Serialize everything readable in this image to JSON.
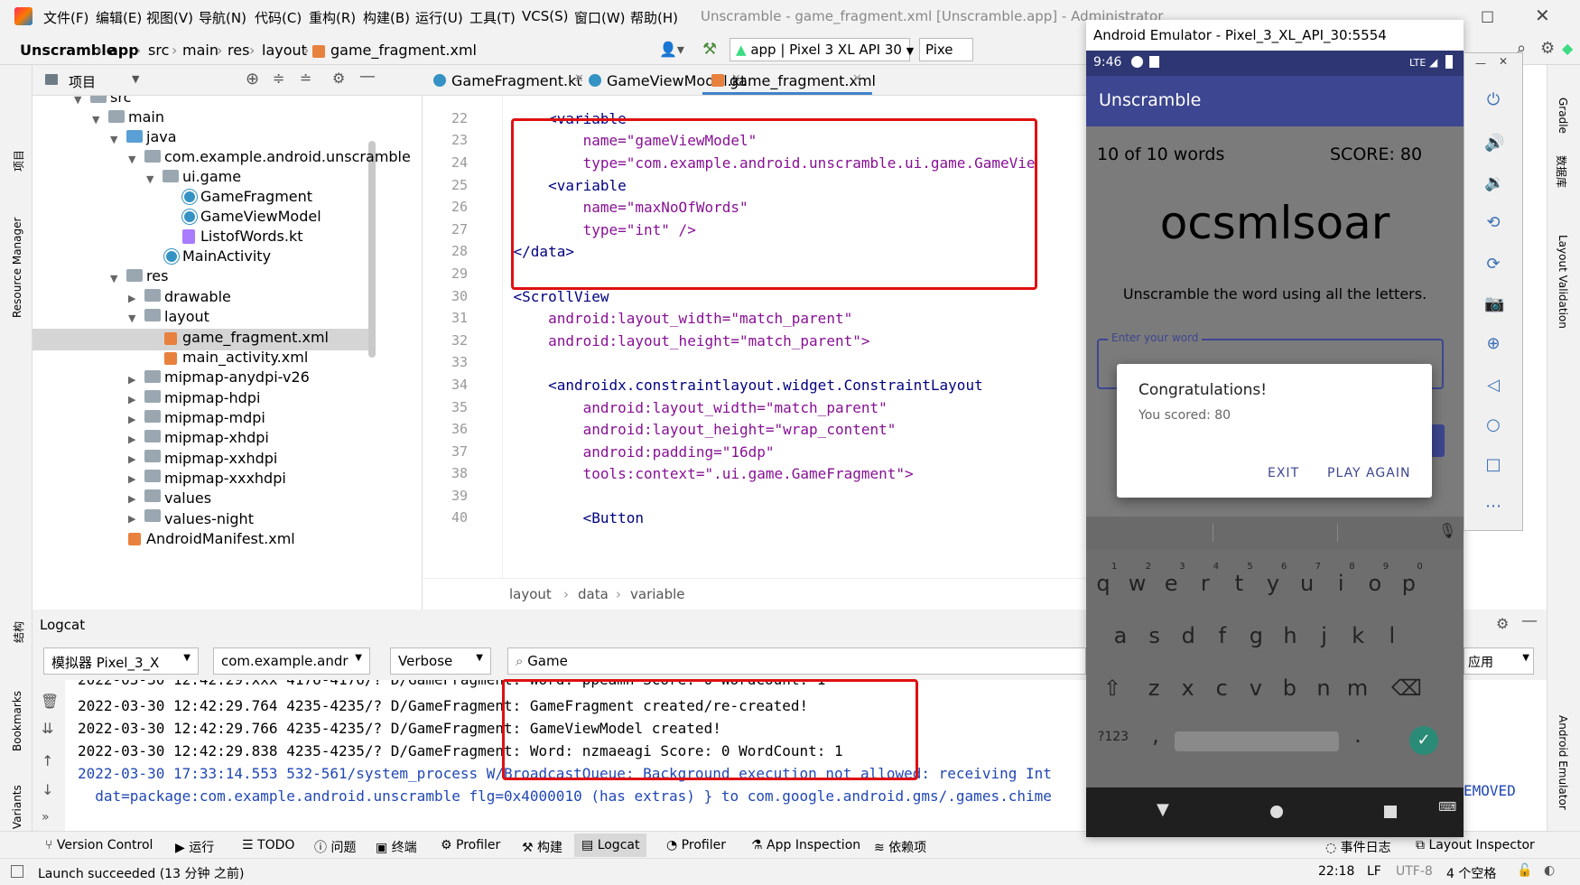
{
  "window": {
    "title": "Unscramble - game_fragment.xml [Unscramble.app] - Administrator",
    "menu": [
      "文件(F)",
      "编辑(E)",
      "视图(V)",
      "导航(N)",
      "代码(C)",
      "重构(R)",
      "构建(B)",
      "运行(U)",
      "工具(T)",
      "VCS(S)",
      "窗口(W)",
      "帮助(H)"
    ]
  },
  "breadcrumb": [
    "Unscramble",
    "app",
    "src",
    "main",
    "res",
    "layout",
    "game_fragment.xml"
  ],
  "run_config": "app | Pixel 3 XL API 30",
  "device_partial": "Pixe",
  "project_panel": {
    "title": "项目",
    "items": [
      {
        "label": "src"
      },
      {
        "label": "main"
      },
      {
        "label": "java"
      },
      {
        "label": "com.example.android.unscramble"
      },
      {
        "label": "ui.game"
      },
      {
        "label": "GameFragment"
      },
      {
        "label": "GameViewModel"
      },
      {
        "label": "ListofWords.kt"
      },
      {
        "label": "MainActivity"
      },
      {
        "label": "res"
      },
      {
        "label": "drawable"
      },
      {
        "label": "layout"
      },
      {
        "label": "game_fragment.xml"
      },
      {
        "label": "main_activity.xml"
      },
      {
        "label": "mipmap-anydpi-v26"
      },
      {
        "label": "mipmap-hdpi"
      },
      {
        "label": "mipmap-mdpi"
      },
      {
        "label": "mipmap-xhdpi"
      },
      {
        "label": "mipmap-xxhdpi"
      },
      {
        "label": "mipmap-xxxhdpi"
      },
      {
        "label": "values"
      },
      {
        "label": "values-night"
      },
      {
        "label": "AndroidManifest.xml"
      }
    ]
  },
  "editor_tabs": [
    "GameFragment.kt",
    "GameViewModel.kt",
    "game_fragment.xml"
  ],
  "editor": {
    "lines": [
      {
        "n": "22",
        "text": "        <variable"
      },
      {
        "n": "23",
        "text": "            name=\"gameViewModel\""
      },
      {
        "n": "24",
        "text": "            type=\"com.example.android.unscramble.ui.game.GameVie"
      },
      {
        "n": "25",
        "text": "        <variable"
      },
      {
        "n": "26",
        "text": "            name=\"maxNoOfWords\""
      },
      {
        "n": "27",
        "text": "            type=\"int\" />"
      },
      {
        "n": "28",
        "text": "    </data>"
      },
      {
        "n": "29",
        "text": ""
      },
      {
        "n": "30",
        "text": "    <ScrollView"
      },
      {
        "n": "31",
        "text": "        android:layout_width=\"match_parent\""
      },
      {
        "n": "32",
        "text": "        android:layout_height=\"match_parent\">"
      },
      {
        "n": "33",
        "text": ""
      },
      {
        "n": "34",
        "text": "        <androidx.constraintlayout.widget.ConstraintLayout"
      },
      {
        "n": "35",
        "text": "            android:layout_width=\"match_parent\""
      },
      {
        "n": "36",
        "text": "            android:layout_height=\"wrap_content\""
      },
      {
        "n": "37",
        "text": "            android:padding=\"16dp\""
      },
      {
        "n": "38",
        "text": "            tools:context=\".ui.game.GameFragment\">"
      },
      {
        "n": "39",
        "text": ""
      },
      {
        "n": "40",
        "text": "            <Button"
      }
    ],
    "crumbs": [
      "layout",
      "data",
      "variable"
    ]
  },
  "logcat": {
    "title": "Logcat",
    "device": "模拟器 Pixel_3_X",
    "package": "com.example.andr",
    "level": "Verbose",
    "search": "Game",
    "lines": [
      {
        "text": "2022-03-30 12:42:29.764 4235-4235/? D/GameFragment: GameFragment created/re-created!",
        "color": "#000000"
      },
      {
        "text": "2022-03-30 12:42:29.766 4235-4235/? D/GameFragment: GameViewModel created!",
        "color": "#000000"
      },
      {
        "text": "2022-03-30 12:42:29.838 4235-4235/? D/GameFragment: Word: nzmaeagi Score: 0 WordCount: 1",
        "color": "#000000"
      },
      {
        "text": "2022-03-30 17:33:14.553 532-561/system_process W/BroadcastQueue: Background execution not allowed: receiving Int",
        "color": "#2047b5"
      },
      {
        "text": "  dat=package:com.example.android.unscramble flg=0x4000010 (has extras) } to com.google.android.gms/.games.chime",
        "color": "#2047b5"
      }
    ],
    "right_fragment": "EMOVED",
    "combo_right": "应用"
  },
  "bottom_tabs": [
    "Version Control",
    "运行",
    "TODO",
    "问题",
    "终端",
    "Profiler",
    "构建",
    "Logcat",
    "Profiler",
    "App Inspection",
    "依赖项"
  ],
  "bottom_right_tabs": [
    "事件日志",
    "Layout Inspector"
  ],
  "status": {
    "message": "Launch succeeded (13 分钟 之前)",
    "pos": "22:18",
    "eol": "LF",
    "enc": "UTF-8",
    "indent": "4 个空格"
  },
  "left_strip": [
    "项目",
    "Resource Manager",
    "结构",
    "Bookmarks",
    "Build Variants"
  ],
  "right_strip": [
    "Gradle",
    "数据库",
    "Layout Validation",
    "Android Emulator"
  ],
  "emulator": {
    "title": "Android Emulator - Pixel_3_XL_API_30:5554",
    "time": "9:46",
    "network": "LTE",
    "app_title": "Unscramble",
    "word_count": "10 of 10 words",
    "score": "SCORE: 80",
    "scrambled": "ocsmlsoar",
    "instructions": "Unscramble the word using all the letters.",
    "input_hint": "Enter your word",
    "dialog_title": "Congratulations!",
    "dialog_msg": "You scored: 80",
    "btn_exit": "EXIT",
    "btn_play": "PLAY AGAIN",
    "kb_row1": [
      "q",
      "w",
      "e",
      "r",
      "t",
      "y",
      "u",
      "i",
      "o",
      "p"
    ],
    "kb_nums": [
      "1",
      "2",
      "3",
      "4",
      "5",
      "6",
      "7",
      "8",
      "9",
      "0"
    ],
    "kb_row2": [
      "a",
      "s",
      "d",
      "f",
      "g",
      "h",
      "j",
      "k",
      "l"
    ],
    "kb_row3": [
      "z",
      "x",
      "c",
      "v",
      "b",
      "n",
      "m"
    ],
    "kb_sym": "?123",
    "kb_comma": ",",
    "kb_dot": "."
  },
  "colors": {
    "accent": "#3d4690",
    "highlight": "#e01010"
  }
}
